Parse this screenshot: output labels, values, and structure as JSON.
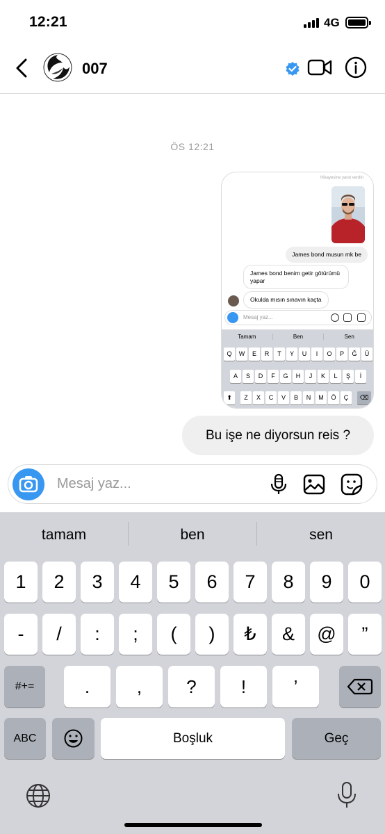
{
  "status_bar": {
    "time": "12:21",
    "network": "4G"
  },
  "header": {
    "contact_name": "007"
  },
  "chat": {
    "timestamp": "ÖS 12:21",
    "screenshot": {
      "story_note": "Hikayesine yanıt verdin",
      "messages": [
        "James bond musun mk be",
        "James bond benim getir götürümü yapar",
        "Okulda mısın sınavın kaçta"
      ],
      "input_placeholder": "Mesaj yaz...",
      "suggestions": [
        "Tamam",
        "Ben",
        "Sen"
      ],
      "keyboard_rows": [
        [
          "Q",
          "W",
          "E",
          "R",
          "T",
          "Y",
          "U",
          "I",
          "O",
          "P",
          "Ğ",
          "Ü"
        ],
        [
          "A",
          "S",
          "D",
          "F",
          "G",
          "H",
          "J",
          "K",
          "L",
          "Ş",
          "İ"
        ],
        [
          "Z",
          "X",
          "C",
          "V",
          "B",
          "N",
          "M",
          "Ö",
          "Ç"
        ]
      ]
    },
    "outgoing_message": "Bu işe ne diyorsun reis ?"
  },
  "composer": {
    "placeholder": "Mesaj yaz..."
  },
  "keyboard": {
    "suggestions": [
      "tamam",
      "ben",
      "sen"
    ],
    "row1": [
      "1",
      "2",
      "3",
      "4",
      "5",
      "6",
      "7",
      "8",
      "9",
      "0"
    ],
    "row2": [
      "-",
      "/",
      ":",
      ";",
      "(",
      ")",
      "₺",
      "&",
      "@",
      "”"
    ],
    "row3": [
      ".",
      ",",
      "?",
      "!",
      "’"
    ],
    "shift_label": "#+=",
    "mode_label": "ABC",
    "space_label": "Boşluk",
    "return_label": "Geç"
  },
  "colors": {
    "accent": "#3897f0",
    "keyboard_bg": "#d2d4d9",
    "bubble": "#efefef"
  }
}
